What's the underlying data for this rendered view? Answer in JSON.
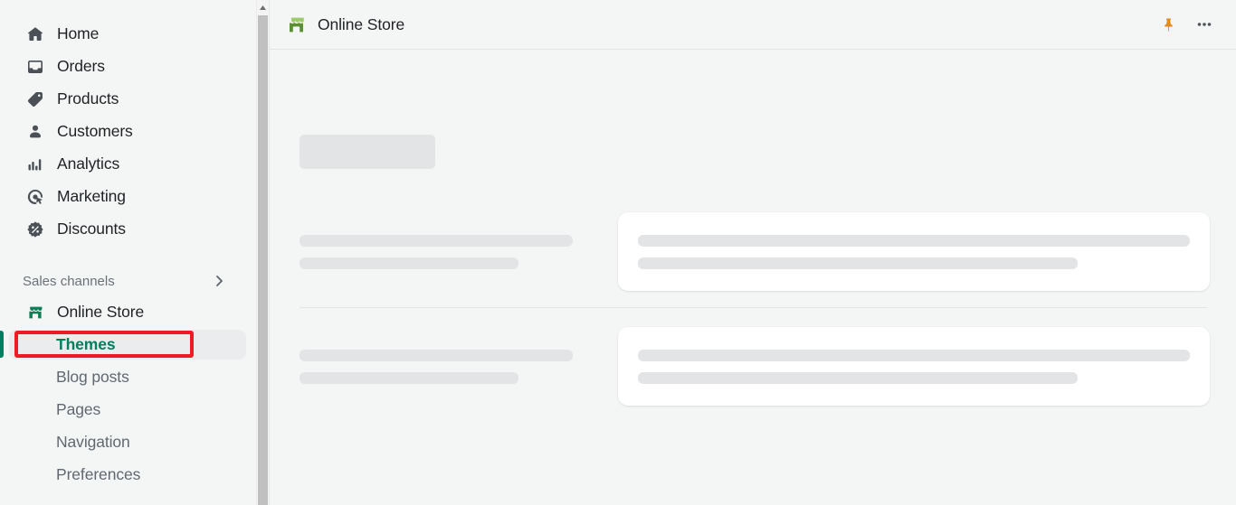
{
  "sidebar": {
    "items": [
      {
        "label": "Home",
        "icon": "home-icon"
      },
      {
        "label": "Orders",
        "icon": "orders-inbox-icon"
      },
      {
        "label": "Products",
        "icon": "product-tag-icon"
      },
      {
        "label": "Customers",
        "icon": "customer-person-icon"
      },
      {
        "label": "Analytics",
        "icon": "analytics-bars-icon"
      },
      {
        "label": "Marketing",
        "icon": "marketing-target-icon"
      },
      {
        "label": "Discounts",
        "icon": "discount-percent-icon"
      }
    ],
    "sales_channels": {
      "label": "Sales channels",
      "chevron_icon": "chevron-right-icon"
    },
    "channel": {
      "label": "Online Store",
      "icon": "storefront-icon"
    },
    "sub_items": [
      {
        "label": "Themes",
        "active": true
      },
      {
        "label": "Blog posts",
        "active": false
      },
      {
        "label": "Pages",
        "active": false
      },
      {
        "label": "Navigation",
        "active": false
      },
      {
        "label": "Preferences",
        "active": false
      }
    ]
  },
  "topbar": {
    "title": "Online Store",
    "store_icon": "storefront-icon",
    "pin_icon": "pin-icon",
    "more_icon": "more-horizontal-icon"
  },
  "colors": {
    "accent_green": "#008060",
    "active_text_green": "#007f5f",
    "annotation_red": "#ed1c24",
    "pin_orange": "#e08c16",
    "skeleton_gray": "#e3e4e6",
    "surface": "#f4f5f5",
    "card": "#ffffff"
  },
  "content": {
    "state": "loading-skeleton",
    "placeholders": 11
  }
}
